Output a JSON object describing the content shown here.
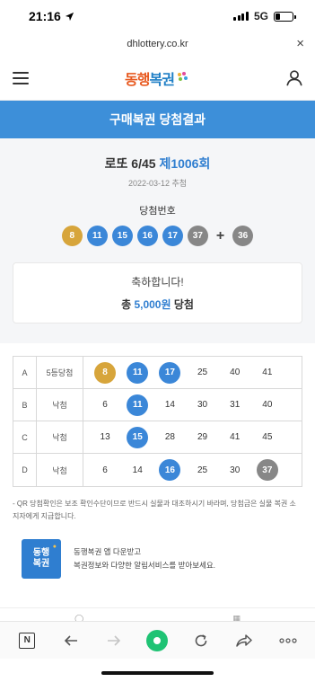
{
  "status_bar": {
    "time": "21:16",
    "network": "5G",
    "battery_level": 0.3
  },
  "browser": {
    "url": "dhlottery.co.kr",
    "close_symbol": "×"
  },
  "site": {
    "logo_text_1": "동행",
    "logo_text_2": "복권",
    "logo_sub": "Donghaeng Lottery"
  },
  "page_title": "구매복권 당첨결과",
  "game": {
    "name": "로또 6/45",
    "round": "제1006회",
    "draw_date": "2022-03-12 추첨",
    "winning_label": "당첨번호",
    "winning_numbers": [
      {
        "n": "8",
        "color": "yellow"
      },
      {
        "n": "11",
        "color": "blue"
      },
      {
        "n": "15",
        "color": "blue"
      },
      {
        "n": "16",
        "color": "blue"
      },
      {
        "n": "17",
        "color": "blue"
      },
      {
        "n": "37",
        "color": "gray"
      }
    ],
    "plus": "+",
    "bonus": {
      "n": "36",
      "color": "gray"
    }
  },
  "result": {
    "message": "축하합니다!",
    "prefix": "총 ",
    "amount": "5,000원",
    "suffix": " 당첨"
  },
  "ticket": {
    "rows": [
      {
        "letter": "A",
        "result": "5등당첨",
        "numbers": [
          {
            "n": "8",
            "style": "yellow"
          },
          {
            "n": "11",
            "style": "blue"
          },
          {
            "n": "17",
            "style": "blue"
          },
          {
            "n": "25",
            "style": "plain"
          },
          {
            "n": "40",
            "style": "plain"
          },
          {
            "n": "41",
            "style": "plain"
          }
        ]
      },
      {
        "letter": "B",
        "result": "낙첨",
        "numbers": [
          {
            "n": "6",
            "style": "plain"
          },
          {
            "n": "11",
            "style": "blue"
          },
          {
            "n": "14",
            "style": "plain"
          },
          {
            "n": "30",
            "style": "plain"
          },
          {
            "n": "31",
            "style": "plain"
          },
          {
            "n": "40",
            "style": "plain"
          }
        ]
      },
      {
        "letter": "C",
        "result": "낙첨",
        "numbers": [
          {
            "n": "13",
            "style": "plain"
          },
          {
            "n": "15",
            "style": "blue"
          },
          {
            "n": "28",
            "style": "plain"
          },
          {
            "n": "29",
            "style": "plain"
          },
          {
            "n": "41",
            "style": "plain"
          },
          {
            "n": "45",
            "style": "plain"
          }
        ]
      },
      {
        "letter": "D",
        "result": "낙첨",
        "numbers": [
          {
            "n": "6",
            "style": "plain"
          },
          {
            "n": "14",
            "style": "plain"
          },
          {
            "n": "16",
            "style": "blue"
          },
          {
            "n": "25",
            "style": "plain"
          },
          {
            "n": "30",
            "style": "plain"
          },
          {
            "n": "37",
            "style": "gray"
          }
        ]
      }
    ]
  },
  "note": "- QR 당첨확인은 보조 확인수단이므로 반드시 실물과 대조하시기 바라며, 당첨금은 실물 복권 소지자에게 지급합니다.",
  "promo": {
    "icon_line1": "동행",
    "icon_line2": "복권",
    "line1": "동행복권 앱 다운받고",
    "line2": "복권정보와 다양한 알림서비스를 받아보세요."
  },
  "toolbar": {
    "n_label": "N"
  },
  "colors": {
    "accent": "#3d8fd9",
    "yellow_ball": "#d7a53b",
    "blue_ball": "#3b87d8",
    "gray_ball": "#878787",
    "naver_green": "#1fc374"
  }
}
